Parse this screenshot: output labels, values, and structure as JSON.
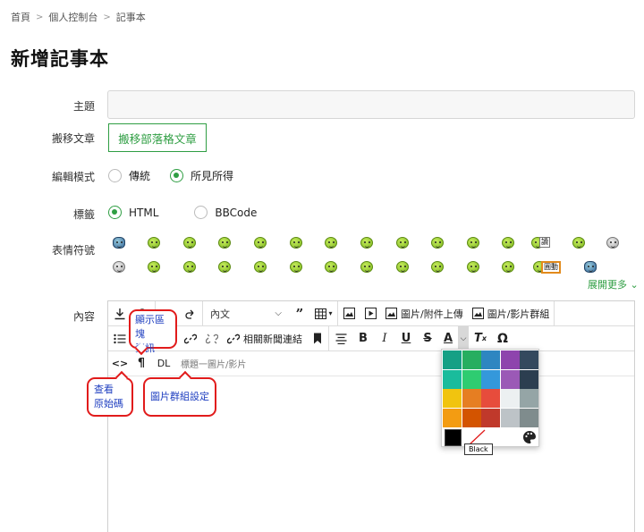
{
  "breadcrumb": [
    "首頁",
    "個人控制台",
    "記事本"
  ],
  "page_title": "新增記事本",
  "form": {
    "subject_label": "主題",
    "subject_value": "",
    "move_label": "搬移文章",
    "move_button": "搬移部落格文章",
    "edit_mode_label": "編輯模式",
    "edit_modes": [
      "傳統",
      "所見所得"
    ],
    "edit_mode_selected": "所見所得",
    "tag_label": "標籤",
    "tag_modes": [
      "HTML",
      "BBCode"
    ],
    "tag_mode_selected": "HTML",
    "emoji_label": "表情符號",
    "emoji_tags": {
      "read": "讀",
      "circle": "圓動"
    },
    "expand_more": "展開更多",
    "content_label": "內容"
  },
  "toolbar": {
    "format_select": "內文",
    "upload_image": "圖片/附件上傳",
    "image_video_group": "圖片/影片群組",
    "related_news_link": "相關新聞連結",
    "dl_label": "DL",
    "caption_placeholder": "標題一圖片/影片"
  },
  "color_panel": {
    "swatches": [
      "#16a085",
      "#27ae60",
      "#2e86c1",
      "#8e44ad",
      "#34495e",
      "#1abc9c",
      "#2ecc71",
      "#3498db",
      "#9b59b6",
      "#2c3e50",
      "#f1c40f",
      "#e67e22",
      "#e74c3c",
      "#ecf0f1",
      "#95a5a6",
      "#f39c12",
      "#d35400",
      "#c0392b",
      "#bdc3c7",
      "#7f8c8d"
    ],
    "selected": "#000000",
    "tooltip": "Black"
  },
  "callouts": {
    "show_block": [
      "顯示區塊",
      "資訊"
    ],
    "view_source": [
      "查看",
      "原始碼"
    ],
    "image_group_settings": "圖片群組設定"
  },
  "colors": {
    "accent": "#2f9e43",
    "callout_border": "#e11b1b",
    "callout_text": "#1f3fc0"
  }
}
